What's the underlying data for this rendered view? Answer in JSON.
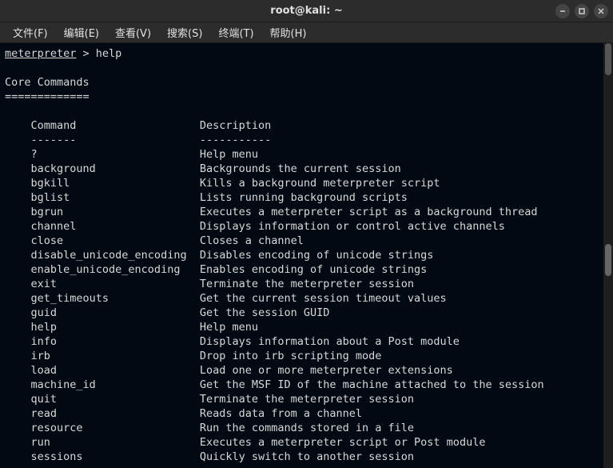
{
  "window": {
    "title": "root@kali: ~"
  },
  "menubar": {
    "items": [
      "文件(F)",
      "编辑(E)",
      "查看(V)",
      "搜索(S)",
      "终端(T)",
      "帮助(H)"
    ]
  },
  "terminal": {
    "prompt_host": "meterpreter",
    "prompt_arrow": " > ",
    "command": "help",
    "section_title": "Core Commands",
    "section_rule": "=============",
    "col_headers": {
      "cmd": "Command",
      "desc": "Description"
    },
    "col_rules": {
      "cmd": "-------",
      "desc": "-----------"
    },
    "commands": [
      {
        "cmd": "?",
        "desc": "Help menu"
      },
      {
        "cmd": "background",
        "desc": "Backgrounds the current session"
      },
      {
        "cmd": "bgkill",
        "desc": "Kills a background meterpreter script"
      },
      {
        "cmd": "bglist",
        "desc": "Lists running background scripts"
      },
      {
        "cmd": "bgrun",
        "desc": "Executes a meterpreter script as a background thread"
      },
      {
        "cmd": "channel",
        "desc": "Displays information or control active channels"
      },
      {
        "cmd": "close",
        "desc": "Closes a channel"
      },
      {
        "cmd": "disable_unicode_encoding",
        "desc": "Disables encoding of unicode strings"
      },
      {
        "cmd": "enable_unicode_encoding",
        "desc": "Enables encoding of unicode strings"
      },
      {
        "cmd": "exit",
        "desc": "Terminate the meterpreter session"
      },
      {
        "cmd": "get_timeouts",
        "desc": "Get the current session timeout values"
      },
      {
        "cmd": "guid",
        "desc": "Get the session GUID"
      },
      {
        "cmd": "help",
        "desc": "Help menu"
      },
      {
        "cmd": "info",
        "desc": "Displays information about a Post module"
      },
      {
        "cmd": "irb",
        "desc": "Drop into irb scripting mode"
      },
      {
        "cmd": "load",
        "desc": "Load one or more meterpreter extensions"
      },
      {
        "cmd": "machine_id",
        "desc": "Get the MSF ID of the machine attached to the session"
      },
      {
        "cmd": "quit",
        "desc": "Terminate the meterpreter session"
      },
      {
        "cmd": "read",
        "desc": "Reads data from a channel"
      },
      {
        "cmd": "resource",
        "desc": "Run the commands stored in a file"
      },
      {
        "cmd": "run",
        "desc": "Executes a meterpreter script or Post module"
      },
      {
        "cmd": "sessions",
        "desc": "Quickly switch to another session"
      }
    ]
  }
}
